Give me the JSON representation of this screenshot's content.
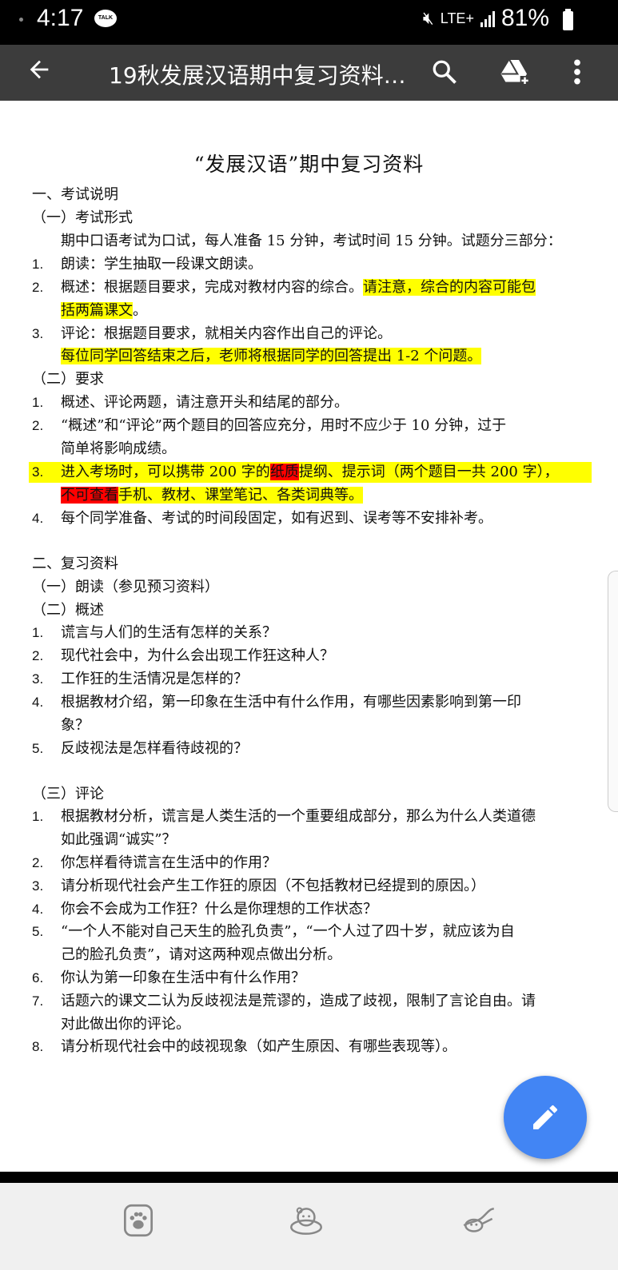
{
  "status_bar": {
    "time": "4:17",
    "talk_badge": "TALK",
    "network": "LTE+",
    "battery": "81%"
  },
  "app_bar": {
    "title": "19秋发展汉语期中复习资料…",
    "icons": [
      "back-arrow-icon",
      "search-icon",
      "add-to-drive-icon",
      "more-vert-icon"
    ]
  },
  "document": {
    "title": "“发展汉语”期中复习资料",
    "sec1": {
      "heading": "一、考试说明",
      "sub1": "（一）考试形式",
      "intro": "期中口语考试为口试，每人准备 15 分钟，考试时间 15 分钟。试题分三部分：",
      "items": [
        {
          "num": "1.",
          "text": "朗读：学生抽取一段课文朗读。"
        },
        {
          "num": "2.",
          "text": "概述：根据题目要求，完成对教材内容的综合。",
          "hl1": "请注意，综合的内容可能包",
          "hl2": "括两篇课文",
          "tail": "。"
        },
        {
          "num": "3.",
          "text": "评论：根据题目要求，就相关内容作出自己的评论。",
          "hl_line": "每位同学回答结束之后，老师将根据同学的回答提出 1-2 个问题。"
        }
      ],
      "sub2": "（二）要求",
      "req": [
        {
          "num": "1.",
          "text": "概述、评论两题，请注意开头和结尾的部分。"
        },
        {
          "num": "2.",
          "text": "“概述”和“评论”两个题目的回答应充分，用时不应少于 10 分钟，过于",
          "cont": "简单将影响成绩。"
        },
        {
          "num": "3.",
          "a": "进入考场时，可以携带 200 字的",
          "red1": "纸质",
          "b": "提纲、提示词（两个题目一共 200 字），",
          "red2": "不可查看",
          "c": "手机、教材、课堂笔记、各类词典等。"
        },
        {
          "num": "4.",
          "text": "每个同学准备、考试的时间段固定，如有迟到、误考等不安排补考。"
        }
      ]
    },
    "sec2": {
      "heading": "二、复习资料",
      "sub1": "（一）朗读（参见预习资料）",
      "sub2": "（二）概述",
      "summary": [
        {
          "num": "1.",
          "text": "谎言与人们的生活有怎样的关系？"
        },
        {
          "num": "2.",
          "text": "现代社会中，为什么会出现工作狂这种人？"
        },
        {
          "num": "3.",
          "text": "工作狂的生活情况是怎样的？"
        },
        {
          "num": "4.",
          "text": "根据教材介绍，第一印象在生活中有什么作用，有哪些因素影响到第一印",
          "cont": "象？"
        },
        {
          "num": "5.",
          "text": "反歧视法是怎样看待歧视的？"
        }
      ],
      "sub3": "（三）评论",
      "comment": [
        {
          "num": "1.",
          "text": "根据教材分析，谎言是人类生活的一个重要组成部分，那么为什么人类道德",
          "cont": "如此强调“诚实”？"
        },
        {
          "num": "2.",
          "text": "你怎样看待谎言在生活中的作用？"
        },
        {
          "num": "3.",
          "text": "请分析现代社会产生工作狂的原因（不包括教材已经提到的原因。）"
        },
        {
          "num": "4.",
          "text": "你会不会成为工作狂？什么是你理想的工作状态？"
        },
        {
          "num": "5.",
          "text": "“一个人不能对自己天生的脸孔负责”，“一个人过了四十岁，就应该为自",
          "cont": "己的脸孔负责”，请对这两种观点做出分析。"
        },
        {
          "num": "6.",
          "text": "你认为第一印象在生活中有什么作用？"
        },
        {
          "num": "7.",
          "text": "话题六的课文二认为反歧视法是荒谬的，造成了歧视，限制了言论自由。请",
          "cont": "对此做出你的评论。"
        },
        {
          "num": "8.",
          "text": "请分析现代社会中的歧视现象（如产生原因、有哪些表现等）。"
        }
      ]
    }
  },
  "fab": {
    "icon": "edit-pencil-icon"
  },
  "bottom_nav": {
    "icons": [
      "paw-icon",
      "ryan-character-icon",
      "dog-character-icon"
    ]
  },
  "colors": {
    "highlight_yellow": "#ffff00",
    "highlight_red": "#ff0000",
    "fab_blue": "#4285f4",
    "app_bar": "#3c3c3c"
  }
}
